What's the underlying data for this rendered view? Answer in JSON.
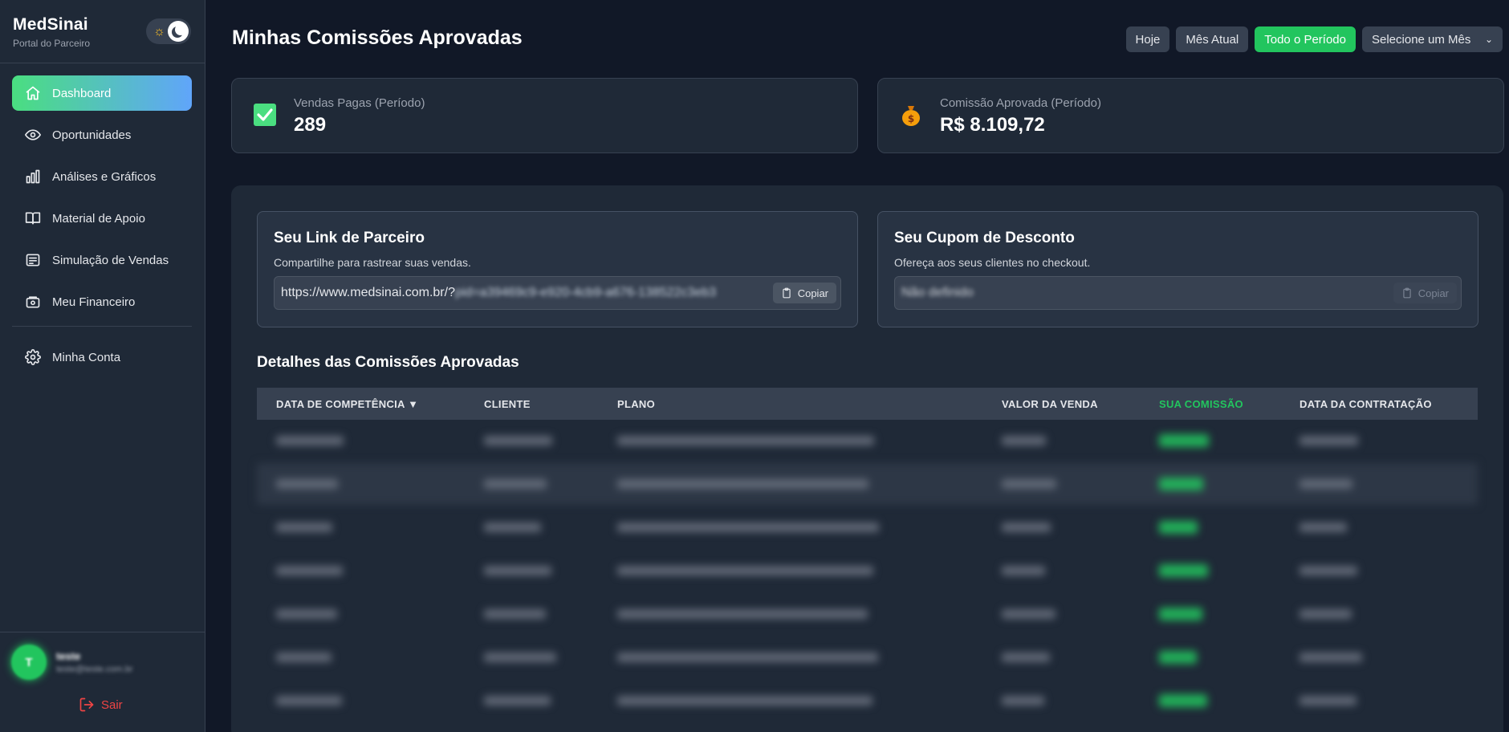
{
  "brand": {
    "title": "MedSinai",
    "subtitle": "Portal do Parceiro"
  },
  "theme_toggle": {
    "sun_icon": "sun-icon",
    "moon_icon": "moon-icon"
  },
  "sidebar": {
    "items": [
      {
        "label": "Dashboard",
        "icon": "home-icon",
        "active": true
      },
      {
        "label": "Oportunidades",
        "icon": "eye-icon"
      },
      {
        "label": "Análises e Gráficos",
        "icon": "bar-chart-icon"
      },
      {
        "label": "Material de Apoio",
        "icon": "book-icon"
      },
      {
        "label": "Simulação de Vendas",
        "icon": "list-icon"
      },
      {
        "label": "Meu Financeiro",
        "icon": "wallet-icon"
      }
    ],
    "account": {
      "label": "Minha Conta",
      "icon": "gear-icon"
    },
    "user": {
      "initial": "T",
      "name": "teste",
      "email": "teste@teste.com.br"
    },
    "logout_label": "Sair"
  },
  "header": {
    "title": "Minhas Comissões Aprovadas",
    "filters": [
      "Hoje",
      "Mês Atual",
      "Todo o Período"
    ],
    "active_filter": "Todo o Período",
    "month_select": "Selecione um Mês"
  },
  "stats": {
    "sales": {
      "label": "Vendas Pagas (Período)",
      "value": "289",
      "icon": "check-square-icon"
    },
    "commission": {
      "label": "Comissão Aprovada (Período)",
      "value": "R$ 8.109,72",
      "icon": "money-bag-icon"
    }
  },
  "partner_link": {
    "title": "Seu Link de Parceiro",
    "description": "Compartilhe para rastrear suas vendas.",
    "url_visible": "https://www.medsinai.com.br/?",
    "url_blurred": "pid=a39469c9-e920-4cb9-a676-138522c3eb3",
    "copy_label": "Copiar"
  },
  "coupon": {
    "title": "Seu Cupom de Desconto",
    "description": "Ofereça aos seus clientes no checkout.",
    "value": "Não definido",
    "copy_label": "Copiar"
  },
  "table": {
    "title": "Detalhes das Comissões Aprovadas",
    "columns": [
      "DATA DE COMPETÊNCIA ▼",
      "CLIENTE",
      "PLANO",
      "VALOR DA VENDA",
      "SUA COMISSÃO",
      "DATA DA CONTRATAÇÃO"
    ],
    "highlight_color": "#22c55e"
  }
}
